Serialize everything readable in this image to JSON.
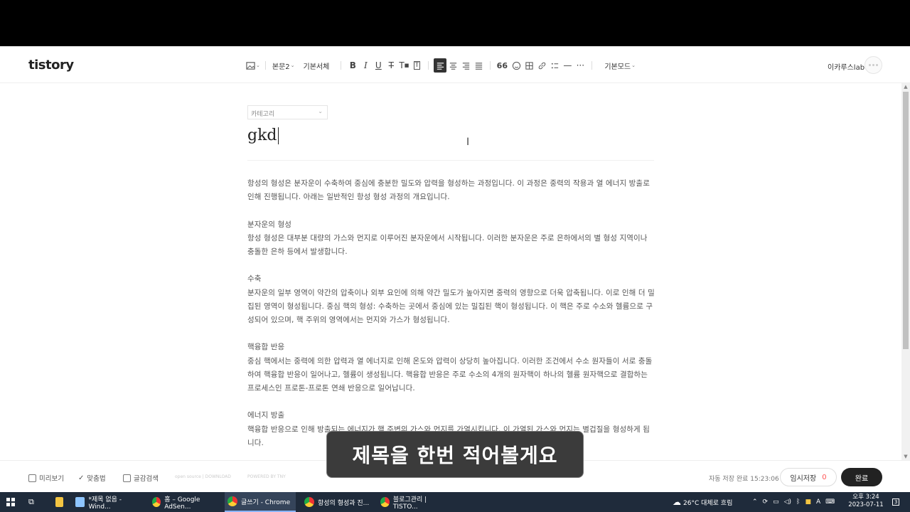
{
  "header": {
    "logo": "tistory",
    "toolbar": {
      "paragraph_style": "본문2",
      "font": "기본서체",
      "mode": "기본모드"
    },
    "user_name": "이카루스lab"
  },
  "editor": {
    "category_placeholder": "카테고리",
    "title": "gkd",
    "paragraphs": [
      "항성의 형성은 분자운이 수축하여 중심에 충분한 밀도와 압력을 형성하는 과정입니다. 이 과정은 중력의 작용과 열 에너지 방출로 인해 진행됩니다. 아래는 일반적인 항성 형성 과정의 개요입니다.",
      "",
      "분자운의 형성",
      "항성 형성은 대부분 대량의 가스와 먼지로 이루어진 분자운에서 시작됩니다. 이러한 분자운은 주로 은하에서의 별 형성 지역이나 충돌한 은하 등에서 발생합니다.",
      "",
      "수축",
      "분자운의 일부 영역이 약간의 압축이나 외부 요인에 의해 약간 밀도가 높아지면 중력의 영향으로 더욱 압축됩니다. 이로 인해 더 밀집된 영역이 형성됩니다. 중심 핵의 형성: 수축하는 곳에서 중심에 있는 밀집된 핵이 형성됩니다. 이 핵은 주로 수소와 헬륨으로 구성되어 있으며, 핵 주위의 영역에서는 먼지와 가스가 형성됩니다.",
      "",
      "핵융합 반응",
      "중심 핵에서는 중력에 의한 압력과 열 에너지로 인해 온도와 압력이 상당히 높아집니다. 이러한 조건에서 수소 원자들이 서로 충돌하여 핵융합 반응이 일어나고, 헬륨이 생성됩니다. 핵융합 반응은 주로 수소의 4개의 원자핵이 하나의 헬륨 원자핵으로 결합하는 프로세스인 프로톤-프로톤 연쇄 반응으로 일어납니다.",
      "",
      "에너지 방출",
      "핵융합 반응으로 인해 방출되는 에너지가 핵 주변의 가스와 먼지를 가열시킵니다. 이 가열된 가스와 먼지는 별겁질을 형성하게 됩니다."
    ]
  },
  "footer": {
    "preview": "미리보기",
    "spellcheck": "맞춤법",
    "search": "글감검색",
    "open_source": "open source | DOWNLOAD",
    "powered": "POWERED BY TNY",
    "autosave": "자동 저장 완료 15:23:06",
    "draft_label": "임시저장",
    "draft_count": "0",
    "done_label": "완료"
  },
  "caption": "제목을 한번 적어볼게요",
  "taskbar": {
    "apps": [
      "*제목 없음 - Wind...",
      "홈 – Google AdSen...",
      "글쓰기 - Chrome",
      "항성의 형성과 진...",
      "블로그관리 | TISTO..."
    ],
    "weather": "26°C 대체로 흐림",
    "ime": "A",
    "time": "오후 3:24",
    "date": "2023-07-11",
    "notifications": "3"
  }
}
